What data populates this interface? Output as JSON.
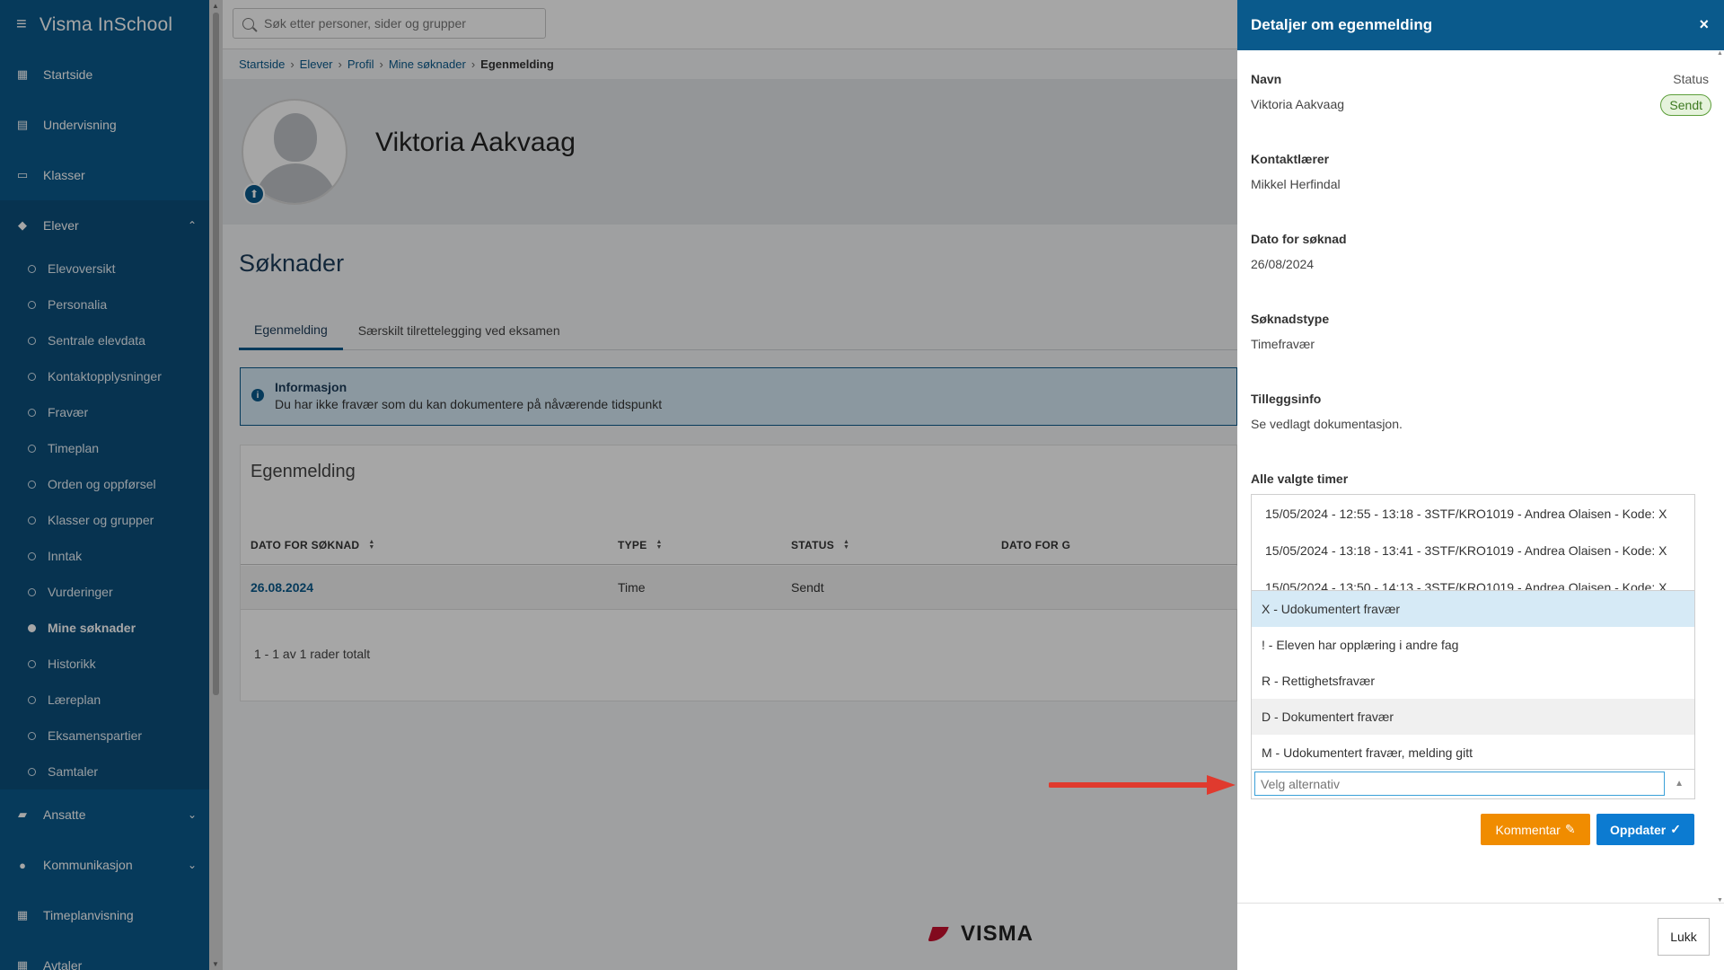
{
  "app": {
    "title": "Visma InSchool"
  },
  "sidebar": {
    "items": [
      {
        "label": "Startside",
        "icon": "grid-icon"
      },
      {
        "label": "Undervisning",
        "icon": "book-icon"
      },
      {
        "label": "Klasser",
        "icon": "chalkboard-icon"
      },
      {
        "label": "Elever",
        "icon": "student-icon"
      }
    ],
    "sub_items": [
      "Elevoversikt",
      "Personalia",
      "Sentrale elevdata",
      "Kontaktopplysninger",
      "Fravær",
      "Timeplan",
      "Orden og oppførsel",
      "Klasser og grupper",
      "Inntak",
      "Vurderinger",
      "Mine søknader",
      "Historikk",
      "Læreplan",
      "Eksamenspartier",
      "Samtaler"
    ],
    "lower_items": [
      {
        "label": "Ansatte",
        "icon": "briefcase-icon"
      },
      {
        "label": "Kommunikasjon",
        "icon": "chat-icon"
      },
      {
        "label": "Timeplanvisning",
        "icon": "calendar-icon"
      },
      {
        "label": "Avtaler",
        "icon": "calendar-check-icon"
      }
    ]
  },
  "search": {
    "placeholder": "Søk etter personer, sider og grupper"
  },
  "breadcrumb": [
    "Startside",
    "Elever",
    "Profil",
    "Mine søknader",
    "Egenmelding"
  ],
  "profile": {
    "name": "Viktoria Aakvaag"
  },
  "page": {
    "title": "Søknader"
  },
  "tabs": [
    "Egenmelding",
    "Særskilt tilrettelegging ved eksamen"
  ],
  "info": {
    "title": "Informasjon",
    "text": "Du har ikke fravær som du kan dokumentere på nåværende tidspunkt"
  },
  "card": {
    "title": "Egenmelding"
  },
  "table": {
    "headers": [
      "DATO FOR SØKNAD",
      "TYPE",
      "STATUS",
      "DATO FOR G"
    ],
    "rows": [
      {
        "date": "26.08.2024",
        "type": "Time",
        "status": "Sendt"
      }
    ],
    "pager": "1 - 1 av 1 rader totalt"
  },
  "brand_footer": "VISMA",
  "drawer": {
    "title": "Detaljer om egenmelding",
    "close_symbol": "×",
    "fields": {
      "name_label": "Navn",
      "name_value": "Viktoria Aakvaag",
      "status_label": "Status",
      "status_value": "Sendt",
      "contact_label": "Kontaktlærer",
      "contact_value": "Mikkel Herfindal",
      "date_label": "Dato for søknad",
      "date_value": "26/08/2024",
      "type_label": "Søknadstype",
      "type_value": "Timefravær",
      "extra_label": "Tilleggsinfo",
      "extra_value": "Se vedlagt dokumentasjon.",
      "hours_label": "Alle valgte timer"
    },
    "hours": [
      "15/05/2024 - 12:55 - 13:18 - 3STF/KRO1019 - Andrea Olaisen - Kode: X",
      "15/05/2024 - 13:18 - 13:41 - 3STF/KRO1019 - Andrea Olaisen - Kode: X",
      "15/05/2024 - 13:50 - 14:13 - 3STF/KRO1019 - Andrea Olaisen - Kode: X"
    ],
    "dropdown": {
      "options": [
        "X - Udokumentert fravær",
        "! - Eleven har opplæring i andre fag",
        "R - Rettighetsfravær",
        "D - Dokumentert fravær",
        "M - Udokumentert fravær, melding gitt"
      ],
      "placeholder": "Velg alternativ"
    },
    "buttons": {
      "comment": "Kommentar",
      "update": "Oppdater",
      "close": "Lukk"
    }
  },
  "colors": {
    "sidebar": "#0a5a8c",
    "header": "#0a5a8c",
    "accent": "#0c7bd1",
    "comment_button": "#f08c00",
    "status_badge": "#5c9e3a",
    "arrow": "#e03a2e"
  }
}
